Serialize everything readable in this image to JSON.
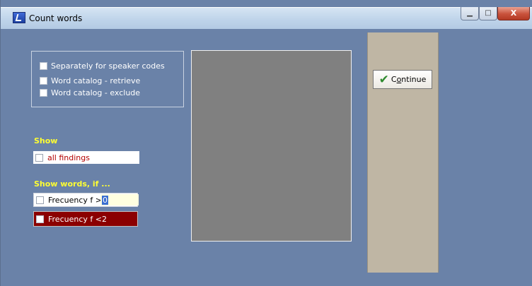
{
  "window": {
    "title": "Count words",
    "controls": {
      "minimize": "▁",
      "maximize": "□",
      "close": "X"
    }
  },
  "options": [
    {
      "label": "Separately for speaker codes",
      "checked": false
    },
    {
      "label": "Word catalog - retrieve",
      "checked": false
    },
    {
      "label": "Word catalog - exclude",
      "checked": false
    }
  ],
  "show": {
    "heading": "Show",
    "all_findings": "all findings"
  },
  "show_words": {
    "heading": "Show words, if ...",
    "freq_gt_label": "Frecuency  f >",
    "freq_gt_value": "0",
    "freq_lt_label": "Frecuency  f <",
    "freq_lt_value": "2"
  },
  "continue_button": {
    "label_first": "C",
    "label_underlined": "o",
    "label_rest": "ntinue",
    "icon": "check-icon"
  },
  "colors": {
    "background": "#6a82a8",
    "heading_yellow": "#ffff33",
    "findings_text": "#b30000",
    "freq_lt_bg": "#8b0000",
    "panel": "#bfb6a4"
  }
}
